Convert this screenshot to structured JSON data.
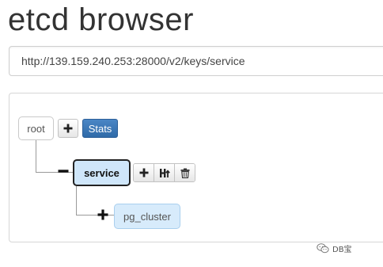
{
  "app": {
    "title": "etcd browser"
  },
  "url_bar": {
    "value": "http://139.159.240.253:28000/v2/keys/service"
  },
  "tree": {
    "root": {
      "label": "root",
      "add_icon": "plus-icon",
      "stats_label": "Stats"
    },
    "service": {
      "label": "service",
      "expanded": true,
      "toggle_icon": "minus-icon",
      "actions": [
        "plus-icon",
        "edit-icon",
        "trash-icon"
      ]
    },
    "pg_cluster": {
      "label": "pg_cluster",
      "expanded": false,
      "toggle_icon": "plus-icon"
    }
  },
  "colors": {
    "stats_button": "#3a78b8",
    "selected_node_bg": "#cfe6fa",
    "child_node_bg": "#d7ebfb"
  },
  "watermark": {
    "text": "DB宝",
    "icon": "wechat-icon"
  }
}
